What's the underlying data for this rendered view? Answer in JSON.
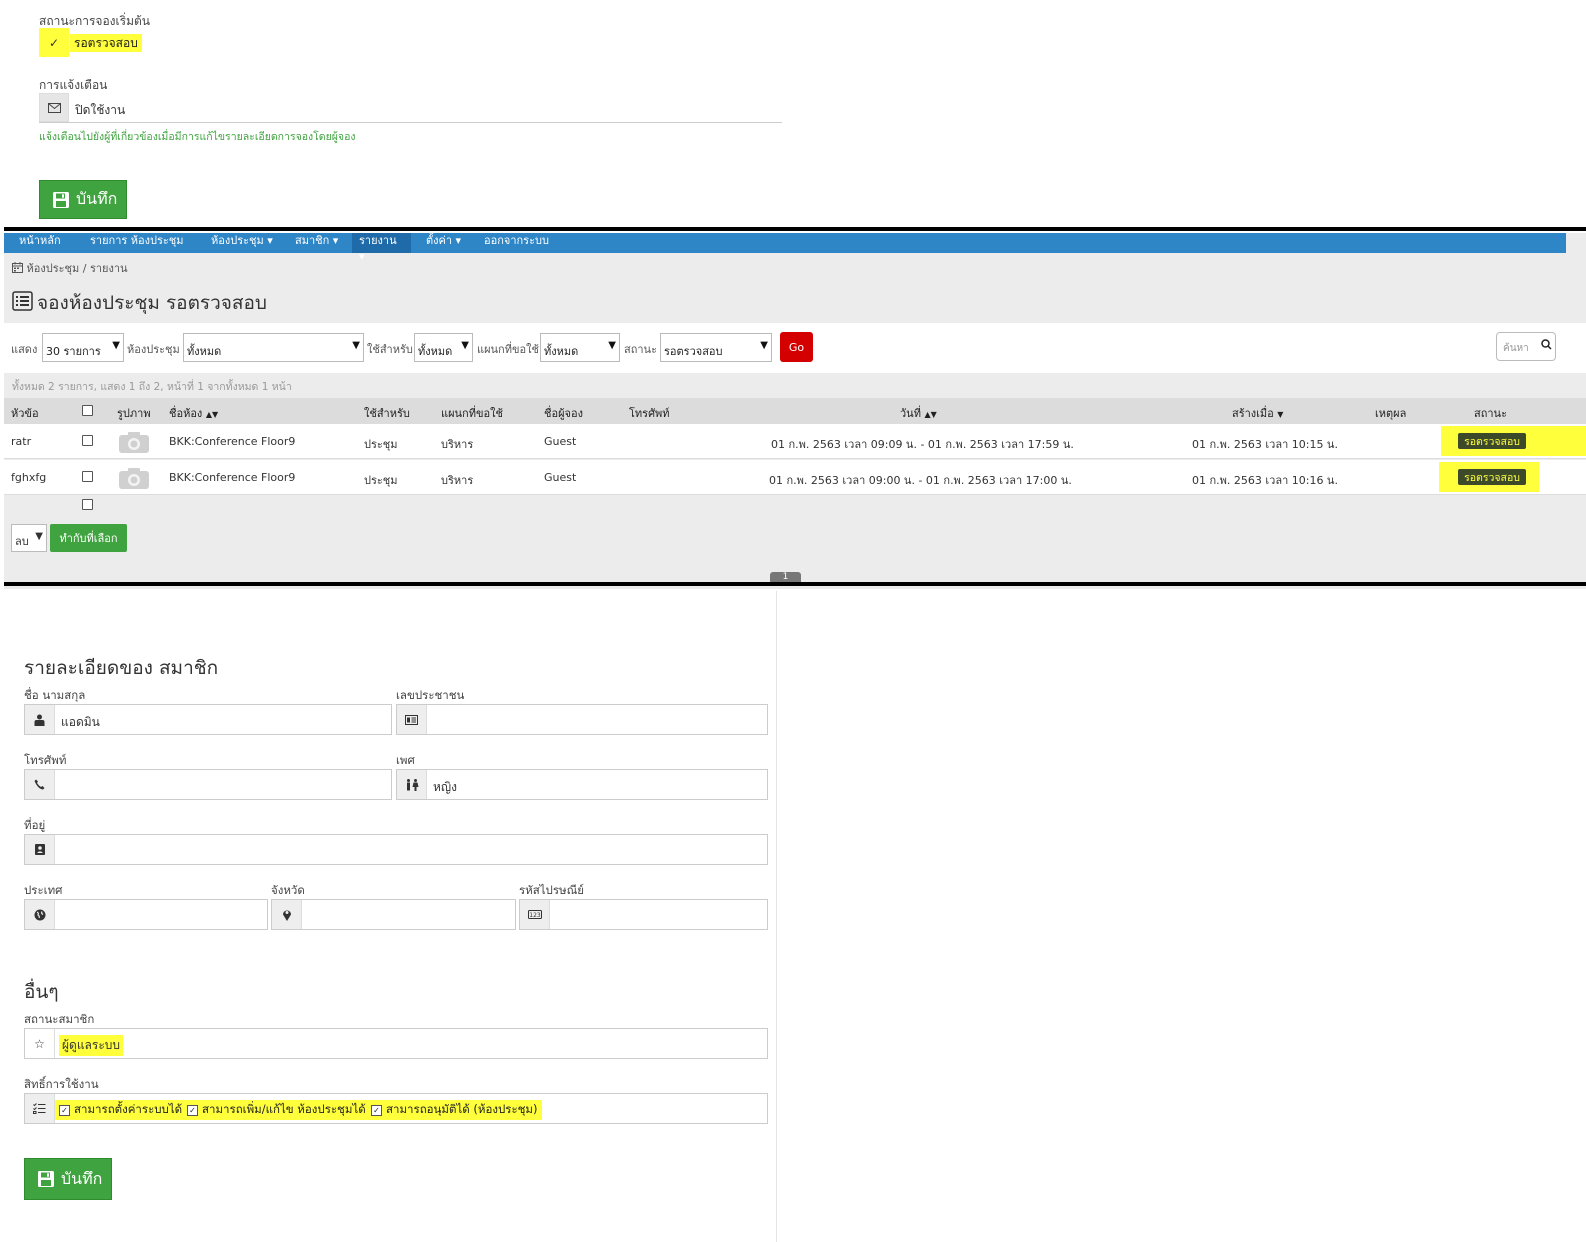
{
  "panel1": {
    "initial_status_label": "สถานะการจองเริ่มต้น",
    "initial_status_value": "รอตรวจสอบ",
    "notify_label": "การแจ้งเตือน",
    "notify_value": "ปิดใช้งาน",
    "notify_help": "แจ้งเตือนไปยังผู้ที่เกี่ยวข้องเมื่อมีการแก้ไขรายละเอียดการจองโดยผู้จอง",
    "save_label": "บันทึก"
  },
  "nav": {
    "items": [
      {
        "label": "หน้าหลัก"
      },
      {
        "label": "รายการ ห้องประชุม"
      },
      {
        "label": "ห้องประชุม ▾"
      },
      {
        "label": "สมาชิก ▾"
      },
      {
        "label": "รายงาน ▾"
      },
      {
        "label": "ตั้งค่า ▾"
      },
      {
        "label": "ออกจากระบบ"
      }
    ],
    "active_index": 4
  },
  "breadcrumb": "ห้องประชุม / รายงาน",
  "page_title": "จองห้องประชุม รอตรวจสอบ",
  "filters": {
    "show_label": "แสดง",
    "show_value": "30 รายการ",
    "room_label": "ห้องประชุม",
    "room_value": "ทั้งหมด",
    "use_label": "ใช้สำหรับ",
    "use_value": "ทั้งหมด",
    "dept_label": "แผนกที่ขอใช้",
    "dept_value": "ทั้งหมด",
    "status_label": "สถานะ",
    "status_value": "รอตรวจสอบ",
    "go_label": "Go",
    "search_placeholder": "ค้นหา"
  },
  "summary": "ทั้งหมด 2 รายการ, แสดง 1 ถึง 2, หน้าที่ 1 จากทั้งหมด 1 หน้า",
  "table": {
    "headers": {
      "topic": "หัวข้อ",
      "image": "รูปภาพ",
      "room": "ชื่อห้อง",
      "use": "ใช้สำหรับ",
      "dept": "แผนกที่ขอใช้",
      "booker": "ชื่อผู้จอง",
      "phone": "โทรศัพท์",
      "date": "วันที่",
      "created": "สร้างเมื่อ",
      "reason": "เหตุผล",
      "status": "สถานะ"
    },
    "rows": [
      {
        "topic": "ratr",
        "room": "BKK:Conference Floor9",
        "use": "ประชุม",
        "dept": "บริหาร",
        "booker": "Guest",
        "phone": "",
        "date": "01 ก.พ. 2563 เวลา 09:09 น. - 01 ก.พ. 2563 เวลา 17:59 น.",
        "created": "01 ก.พ. 2563 เวลา 10:15 น.",
        "reason": "",
        "status": "รอตรวจสอบ"
      },
      {
        "topic": "fghxfg",
        "room": "BKK:Conference Floor9",
        "use": "ประชุม",
        "dept": "บริหาร",
        "booker": "Guest",
        "phone": "",
        "date": "01 ก.พ. 2563 เวลา 09:00 น. - 01 ก.พ. 2563 เวลา 17:00 น.",
        "created": "01 ก.พ. 2563 เวลา 10:16 น.",
        "reason": "",
        "status": "รอตรวจสอบ"
      }
    ]
  },
  "bulk": {
    "action_value": "ลบ",
    "apply_label": "ทำกับที่เลือก",
    "page_number": "1"
  },
  "member": {
    "title": "รายละเอียดของ สมาชิก",
    "name_label": "ชื่อ นามสกุล",
    "name_value": "แอดมิน",
    "idcard_label": "เลขประชาชน",
    "idcard_value": "",
    "phone_label": "โทรศัพท์",
    "phone_value": "",
    "sex_label": "เพศ",
    "sex_value": "หญิง",
    "address_label": "ที่อยู่",
    "address_value": "",
    "country_label": "ประเทศ",
    "province_label": "จังหวัด",
    "zipcode_label": "รหัสไปรษณีย์",
    "other_title": "อื่นๆ",
    "status_label": "สถานะสมาชิก",
    "status_value": "ผู้ดูแลระบบ",
    "perm_label": "สิทธิ์การใช้งาน",
    "perm_items": [
      "สามารถตั้งค่าระบบได้",
      "สามารถเพิ่ม/แก้ไข ห้องประชุมได้",
      "สามารถอนุมัติได้ (ห้องประชุม)"
    ],
    "save_label": "บันทึก"
  },
  "colors": {
    "highlight": "#ffff3c",
    "nav_blue": "#2f86c6",
    "save_green": "#3fa33f",
    "go_red": "#d40000",
    "badge_dark": "#3d4a2a",
    "help_text_green": "#3fa33f"
  }
}
